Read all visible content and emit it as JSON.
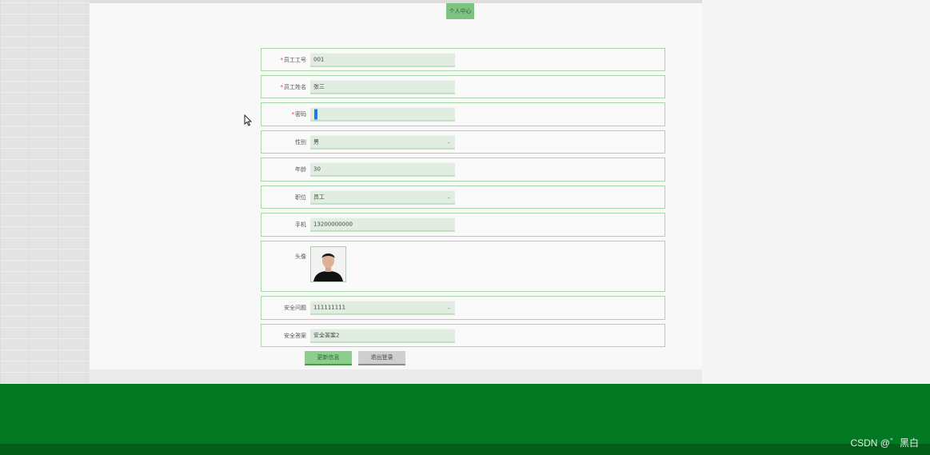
{
  "tab": {
    "label": "个人中心"
  },
  "form": {
    "fields": [
      {
        "label": "员工工号",
        "required": true,
        "value": "001",
        "type": "text"
      },
      {
        "label": "员工姓名",
        "required": true,
        "value": "张三",
        "type": "text"
      },
      {
        "label": "密码",
        "required": true,
        "value": "",
        "type": "password-focused"
      },
      {
        "label": "性别",
        "required": false,
        "value": "男",
        "type": "select"
      },
      {
        "label": "年龄",
        "required": false,
        "value": "30",
        "type": "text"
      },
      {
        "label": "职位",
        "required": false,
        "value": "员工",
        "type": "select"
      },
      {
        "label": "手机",
        "required": false,
        "value": "13200000000",
        "type": "text"
      },
      {
        "label": "头像",
        "required": false,
        "value": "",
        "type": "image"
      },
      {
        "label": "安全问题",
        "required": false,
        "value": "111111111",
        "type": "select"
      },
      {
        "label": "安全答案",
        "required": false,
        "value": "安全答案2",
        "type": "text"
      }
    ]
  },
  "buttons": {
    "update": "更新信息",
    "logout": "退出登录"
  },
  "watermark": "CSDN @゛黑白",
  "colors": {
    "accent": "#7fc382",
    "footer": "#027823",
    "input_bg": "#e2ede2"
  },
  "icons": {
    "cursor": "mouse-pointer-icon",
    "select_arrow": "chevron-down-icon"
  }
}
